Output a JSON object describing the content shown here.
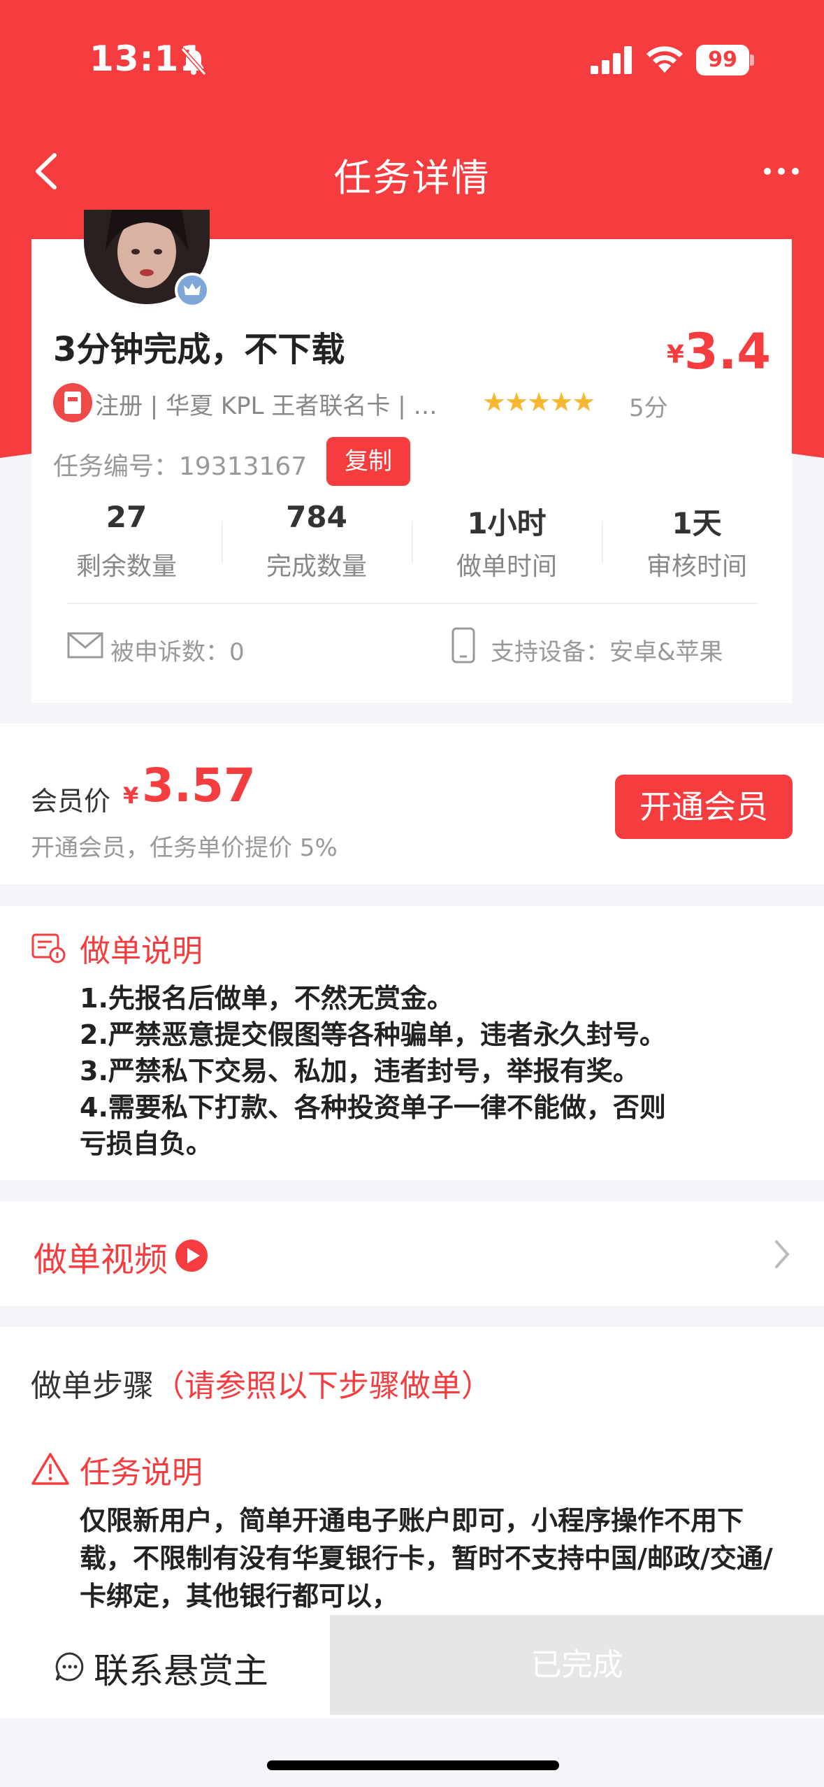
{
  "status_bar": {
    "time": "13:11",
    "battery": "99"
  },
  "nav": {
    "title": "任务详情"
  },
  "task": {
    "title": "3分钟完成，不下载",
    "currency": "¥",
    "price": "3.4",
    "tags": "注册 | 华夏 KPL 王者联名卡 | 评...",
    "stars": "★★★★★",
    "score": "5分",
    "code_label": "任务编号：19313167",
    "copy_label": "复制",
    "stats": [
      {
        "value": "27",
        "label": "剩余数量"
      },
      {
        "value": "784",
        "label": "完成数量"
      },
      {
        "value": "1小时",
        "label": "做单时间"
      },
      {
        "value": "1天",
        "label": "审核时间"
      }
    ],
    "complaints": "被申诉数：0",
    "devices": "支持设备：安卓&苹果"
  },
  "member": {
    "label": "会员价",
    "currency": "¥",
    "price": "3.57",
    "subtitle": "开通会员，任务单价提价 5%",
    "button": "开通会员"
  },
  "instructions": {
    "title": "做单说明",
    "lines": [
      "1.先报名后做单，不然无赏金。",
      "2.严禁恶意提交假图等各种骗单，违者永久封号。",
      "3.严禁私下交易、私加，违者封号，举报有奖。",
      "4.需要私下打款、各种投资单子一律不能做，否则",
      "亏损自负。"
    ]
  },
  "video": {
    "title": "做单视频"
  },
  "steps": {
    "title": "做单步骤",
    "hint": "（请参照以下步骤做单）",
    "warn_title": "任务说明",
    "warn_text": "仅限新用户，简单开通电子账户即可，小程序操作不用下载，不限制有没有华夏银行卡，暂时不支持中国/邮政/交通/卡绑定，其他银行都可以，"
  },
  "bottom": {
    "contact": "联系悬赏主",
    "done": "已完成"
  },
  "colors": {
    "accent": "#f53d3f",
    "star": "#f8b731"
  }
}
